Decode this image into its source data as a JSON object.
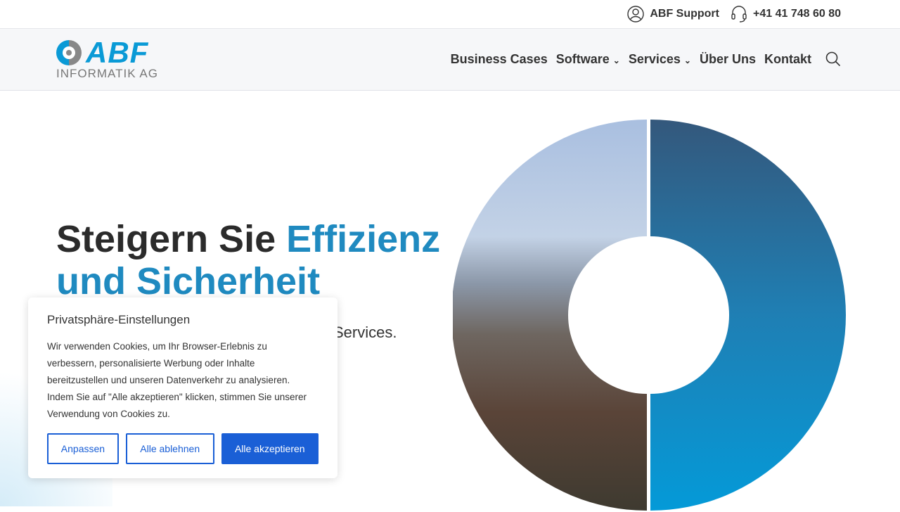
{
  "topbar": {
    "support": "ABF Support",
    "phone": "+41 41 748 60 80"
  },
  "logo": {
    "name": "ABF",
    "subtitle": "INFORMATIK AG"
  },
  "nav": {
    "items": [
      "Business Cases",
      "Software",
      "Services",
      "Über Uns",
      "Kontakt"
    ]
  },
  "hero": {
    "title_1": "Steigern Sie ",
    "title_accent_1": "Effizienz",
    "title_accent_2": "und Sicherheit",
    "subtitle_visible": "Services."
  },
  "cookie": {
    "title": "Privatsphäre-Einstellungen",
    "text": "Wir verwenden Cookies, um Ihr Browser-Erlebnis zu verbessern, personalisierte Werbung oder Inhalte bereitzustellen und unseren Datenverkehr zu analysieren. Indem Sie auf \"Alle akzeptieren\" klicken, stimmen Sie unserer Verwendung von Cookies zu.",
    "customize": "Anpassen",
    "reject": "Alle ablehnen",
    "accept": "Alle akzeptieren"
  },
  "colors": {
    "accent": "#1f8ac0",
    "button": "#1a5fd6",
    "logo": "#0a9ad6"
  }
}
